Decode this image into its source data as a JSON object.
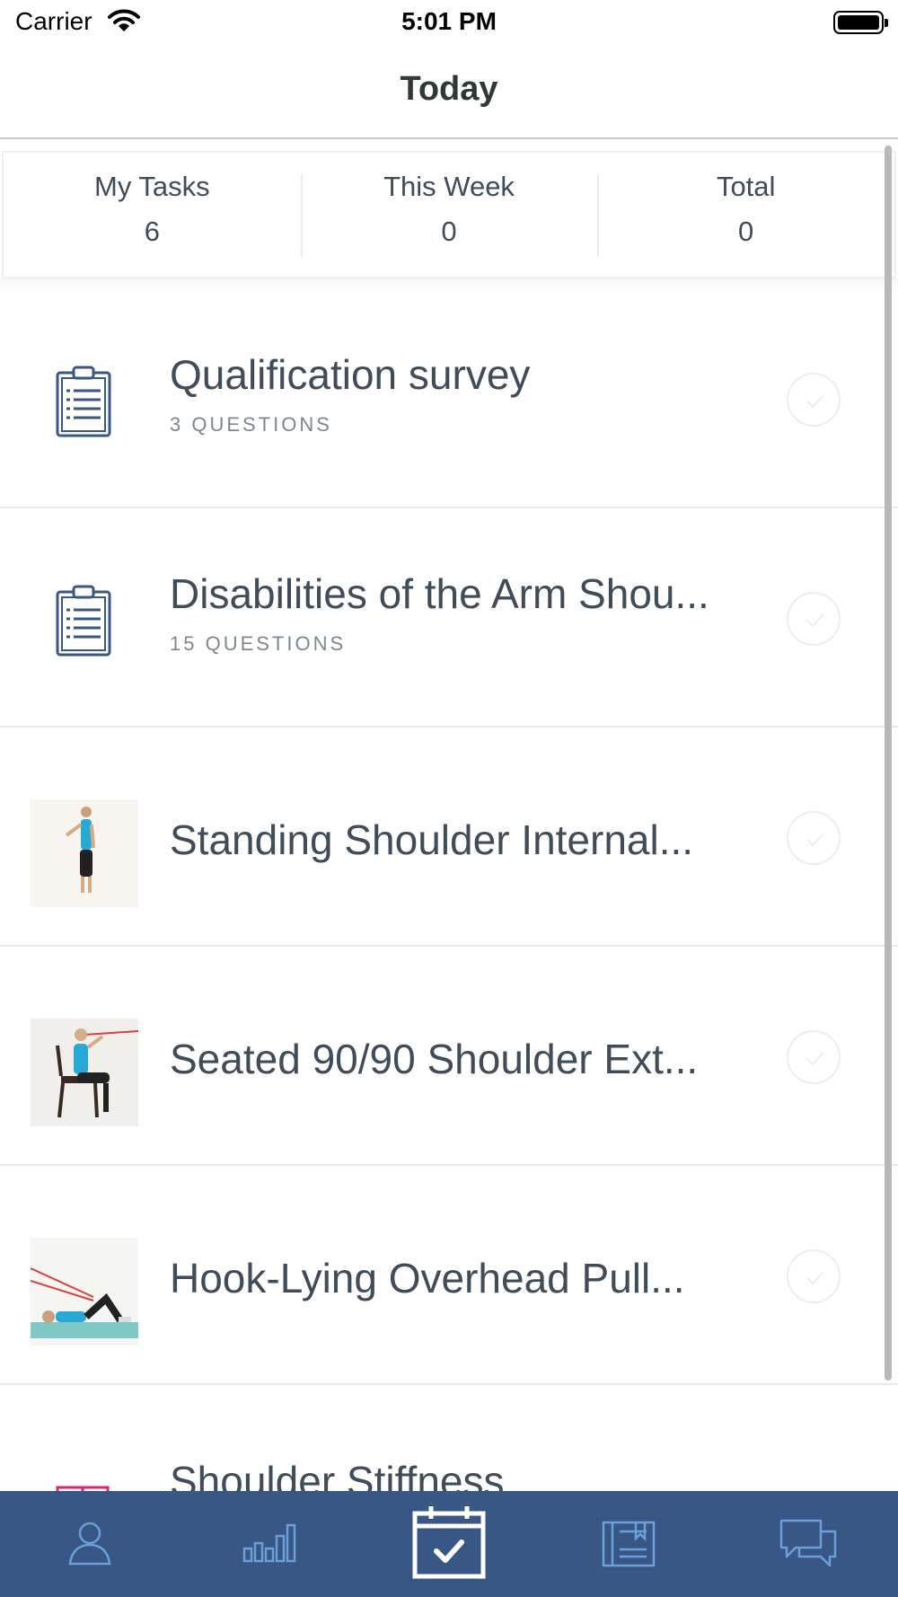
{
  "status_bar": {
    "carrier": "Carrier",
    "time": "5:01 PM"
  },
  "nav": {
    "title": "Today"
  },
  "stats": [
    {
      "label": "My Tasks",
      "value": "6"
    },
    {
      "label": "This Week",
      "value": "0"
    },
    {
      "label": "Total",
      "value": "0"
    }
  ],
  "tasks": [
    {
      "title": "Qualification survey",
      "subtitle": "3 QUESTIONS",
      "icon": "clipboard-icon",
      "completed": false
    },
    {
      "title": "Disabilities of the Arm Shou...",
      "subtitle": "15 QUESTIONS",
      "icon": "clipboard-icon",
      "completed": false
    },
    {
      "title": "Standing Shoulder Internal...",
      "icon": "exercise-thumbnail",
      "completed": false
    },
    {
      "title": "Seated 90/90 Shoulder Ext...",
      "icon": "exercise-thumbnail",
      "completed": false
    },
    {
      "title": "Hook-Lying Overhead Pull...",
      "icon": "exercise-thumbnail",
      "completed": false
    },
    {
      "title": "Shoulder Stiffness",
      "icon": "education-icon",
      "completed": false
    }
  ],
  "tabs": [
    {
      "icon": "profile-icon",
      "selected": false
    },
    {
      "icon": "progress-chart-icon",
      "selected": false
    },
    {
      "icon": "calendar-check-icon",
      "selected": true
    },
    {
      "icon": "education-icon",
      "selected": false
    },
    {
      "icon": "messages-icon",
      "selected": false
    }
  ],
  "colors": {
    "tab_bar": "#385785",
    "text": "#3f4c59",
    "subtle": "#7d8792",
    "accent_education": "#d9276d"
  }
}
